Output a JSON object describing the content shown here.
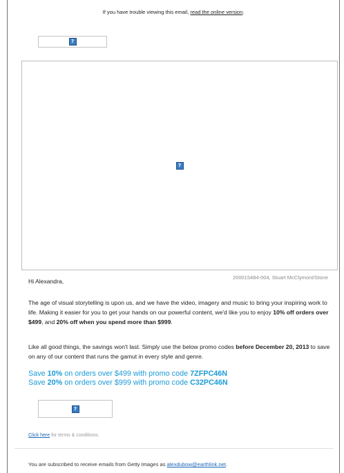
{
  "header": {
    "trouble_text": "If you have trouble viewing this email, ",
    "online_link": "read the online version",
    "trouble_end": "."
  },
  "images": {
    "logo_icon": "?",
    "hero_icon": "?",
    "promo_icon": "?"
  },
  "hero": {
    "credit": "200015484-004, Stuart McClymont/Stone"
  },
  "body": {
    "greeting": "Hi Alexandra,",
    "p1_a": "The age of visual storytelling is upon us, and we have the video, imagery and music to bring your inspiring work to life. Making it easier for you to get your hands on our powerful content, we'd like you to enjoy ",
    "p1_b": "10% off orders over $499",
    "p1_c": ", and ",
    "p1_d": "20% off when you spend more than $999",
    "p1_e": ".",
    "p2_a": "Like all good things, the savings won't last. Simply use the below promo codes ",
    "p2_b": "before December 20, 2013",
    "p2_c": " to save on any of our content that runs the gamut in every style and genre."
  },
  "promos": [
    {
      "prefix": "Save ",
      "pct": "10%",
      "middle": " on orders over $499 with promo code ",
      "code": "7ZFPC46N"
    },
    {
      "prefix": "Save ",
      "pct": "20%",
      "middle": " on orders over $999 with promo code ",
      "code": "C32PC46N"
    }
  ],
  "terms": {
    "link": "Click here",
    "text": " for terms & conditions."
  },
  "footer": {
    "text": "You are subscribed to receive emails from Getty Images as ",
    "email": "alexdubow@earthlink.net",
    "end": "."
  },
  "colors": {
    "promo_blue": "#1b9bd7",
    "link_blue": "#1a66b8",
    "icon_blue": "#3b7dc4"
  }
}
